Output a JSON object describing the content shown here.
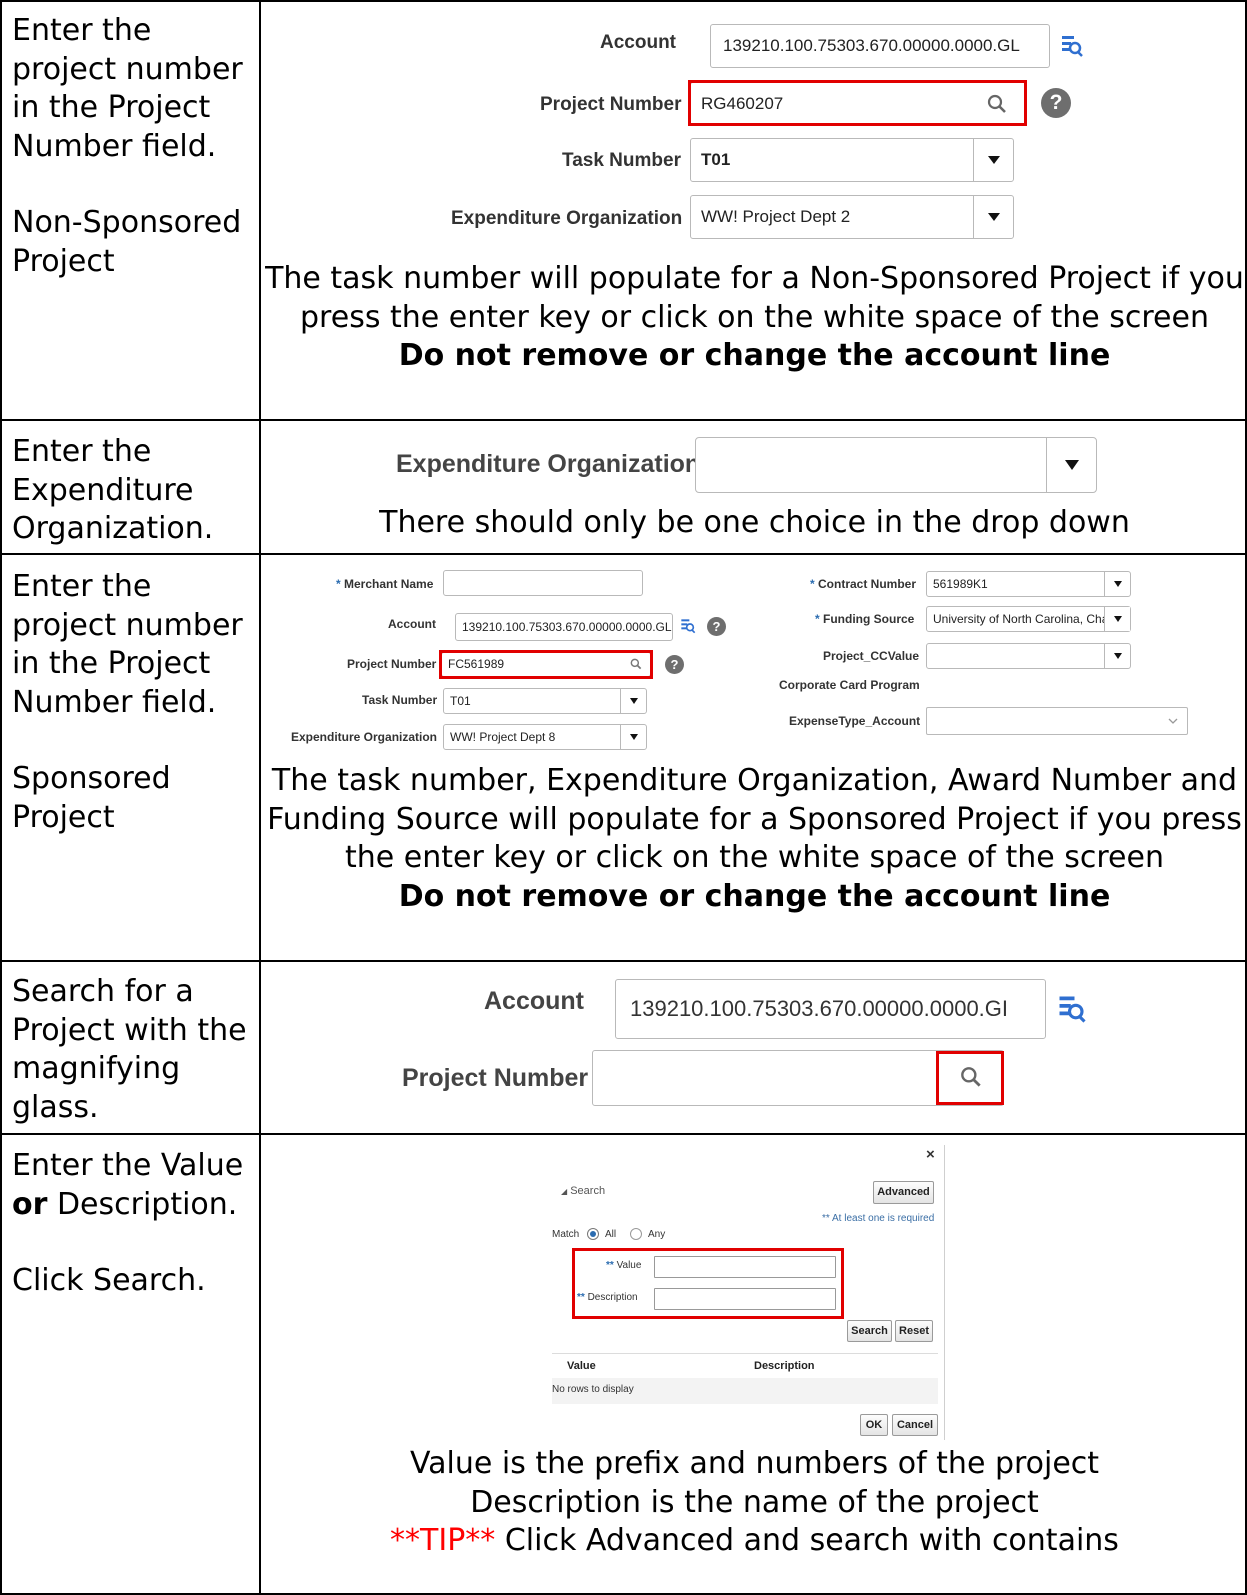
{
  "rows": [
    {
      "left": [
        "Enter the project number in the Project Number field.",
        "Non-Sponsored Project"
      ],
      "form": {
        "account_label": "Account",
        "account_value": "139210.100.75303.670.00000.0000.GL",
        "project_label": "Project Number",
        "project_value": "RG460207",
        "task_label": "Task Number",
        "task_value": "T01",
        "exp_label": "Expenditure Organization",
        "exp_value": "WW! Project Dept 2"
      },
      "caption": "The task number will populate for a Non-Sponsored Project if you press the enter key or click on the white space of the screen",
      "warning": "Do not remove or change the account line"
    },
    {
      "left": [
        "Enter the Expenditure Organization."
      ],
      "form": {
        "exp_label": "Expenditure Organization"
      },
      "caption": "There should only be one choice in the drop down"
    },
    {
      "left": [
        "Enter the project number in the Project Number field.",
        "Sponsored Project"
      ],
      "form": {
        "merchant_label": "Merchant Name",
        "account_label": "Account",
        "account_value": "139210.100.75303.670.00000.0000.GL",
        "project_label": "Project Number",
        "project_value": "FC561989",
        "task_label": "Task Number",
        "task_value": "T01",
        "exp_label": "Expenditure Organization",
        "exp_value": "WW! Project Dept 8",
        "contract_label": "Contract Number",
        "contract_value": "561989K1",
        "funding_label": "Funding Source",
        "funding_value": "University of North Carolina, Cha",
        "ccvalue_label": "Project_CCValue",
        "corp_label": "Corporate Card Program",
        "expense_label": "ExpenseType_Account"
      },
      "caption": "The task number, Expenditure Organization, Award Number and Funding Source will populate for a Sponsored Project if you press the enter key or click on the white space of the screen",
      "warning": "Do not remove or change the account line"
    },
    {
      "left": [
        "Search for a Project with the magnifying glass."
      ],
      "form": {
        "account_label": "Account",
        "account_value": "139210.100.75303.670.00000.0000.GI",
        "project_label": "Project Number"
      }
    },
    {
      "left_parts": [
        "Enter the Value ",
        "or",
        " Description."
      ],
      "left2": "Click Search.",
      "dialog": {
        "close": "×",
        "search_label": "Search",
        "advanced_label": "Advanced",
        "required_note": "** At least one is required",
        "match_label": "Match",
        "all_label": "All",
        "any_label": "Any",
        "stars": "**",
        "value_label": "Value",
        "desc_label": "Description",
        "search_btn": "Search",
        "reset_btn": "Reset",
        "col_value": "Value",
        "col_desc": "Description",
        "empty": "No rows to display",
        "ok_btn": "OK",
        "cancel_btn": "Cancel"
      },
      "captions": [
        "Value is the prefix and numbers of the project",
        "Description is the name of the project"
      ],
      "tip_prefix": "**TIP**",
      "tip_text": " Click Advanced and search with contains"
    }
  ],
  "colors": {
    "red_highlight": "#e10000",
    "tip_red": "#ff0000",
    "help_icon": "#6e6e6e"
  }
}
